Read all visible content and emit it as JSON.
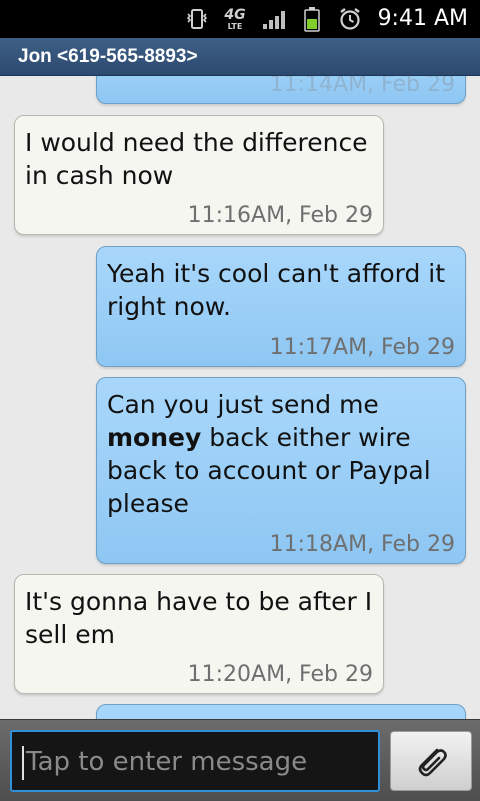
{
  "status_bar": {
    "time": "9:41 AM",
    "network_badge": "4G",
    "network_sub": "LTE",
    "icons": [
      "vibrate-icon",
      "lte-4g-icon",
      "signal-icon",
      "battery-icon",
      "alarm-icon"
    ]
  },
  "title_bar": {
    "contact": "Jon <619-565-8893>"
  },
  "messages": [
    {
      "direction": "outgoing",
      "partial": true,
      "text": "",
      "time": "11:14AM, Feb 29"
    },
    {
      "direction": "incoming",
      "text": "I would need the difference in cash now",
      "time": "11:16AM, Feb 29"
    },
    {
      "direction": "outgoing",
      "text": "Yeah it's cool can't afford it right now.",
      "time": "11:17AM, Feb 29"
    },
    {
      "direction": "outgoing",
      "text_before": "Can you just send me ",
      "text_bold": "money",
      "text_after": " back either wire back to account or Paypal please",
      "time": "11:18AM, Feb 29"
    },
    {
      "direction": "incoming",
      "text": "It's gonna have to be after I sell em",
      "time": "11:20AM, Feb 29"
    },
    {
      "direction": "outgoing",
      "partial": true,
      "text": "",
      "time": ""
    }
  ],
  "composer": {
    "placeholder": "Tap to enter message",
    "attach_icon": "paperclip-icon"
  },
  "colors": {
    "incoming_bubble": "#f6f6f0",
    "outgoing_bubble": "#9fd0f8",
    "title_bar": "#35557b",
    "input_border": "#2f8fd8"
  }
}
